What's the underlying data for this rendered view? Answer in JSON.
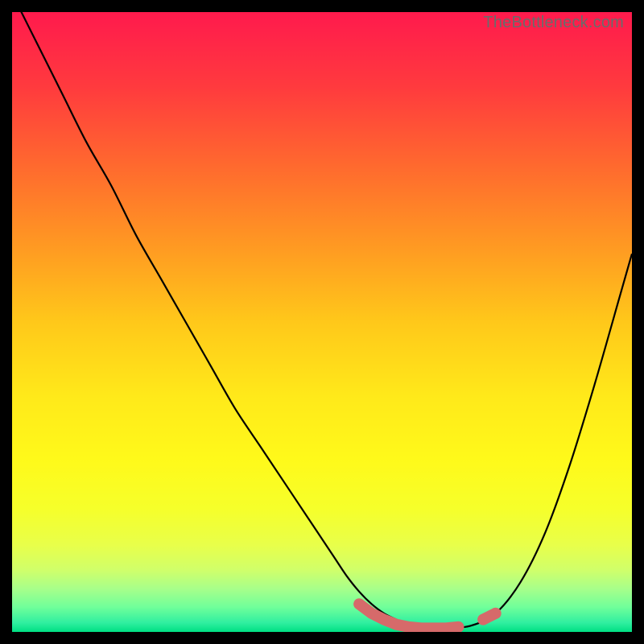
{
  "watermark": "TheBottleneck.com",
  "colors": {
    "black": "#000000",
    "curve": "#000000",
    "marker": "#d66a6a",
    "gradient_stops": [
      {
        "offset": 0.0,
        "color": "#ff1a4d"
      },
      {
        "offset": 0.12,
        "color": "#ff3a3e"
      },
      {
        "offset": 0.25,
        "color": "#ff6a2e"
      },
      {
        "offset": 0.38,
        "color": "#ff9a22"
      },
      {
        "offset": 0.5,
        "color": "#ffc81a"
      },
      {
        "offset": 0.62,
        "color": "#ffe91a"
      },
      {
        "offset": 0.72,
        "color": "#fff91a"
      },
      {
        "offset": 0.8,
        "color": "#f6ff2a"
      },
      {
        "offset": 0.86,
        "color": "#e8ff4a"
      },
      {
        "offset": 0.9,
        "color": "#d0ff6a"
      },
      {
        "offset": 0.93,
        "color": "#a8ff8a"
      },
      {
        "offset": 0.96,
        "color": "#70ff9a"
      },
      {
        "offset": 0.985,
        "color": "#30efa0"
      },
      {
        "offset": 1.0,
        "color": "#00e083"
      }
    ]
  },
  "chart_data": {
    "type": "line",
    "title": "",
    "xlabel": "",
    "ylabel": "",
    "xlim": [
      0,
      100
    ],
    "ylim": [
      0,
      100
    ],
    "grid": false,
    "legend": false,
    "x": [
      0,
      4,
      8,
      12,
      16,
      20,
      24,
      28,
      32,
      36,
      40,
      44,
      48,
      50,
      52,
      54,
      56,
      58,
      60,
      62,
      64,
      66,
      68,
      70,
      74,
      78,
      82,
      86,
      90,
      94,
      98,
      100
    ],
    "series": [
      {
        "name": "bottleneck-curve",
        "values": [
          103,
          95,
          87,
          79,
          72,
          64,
          57,
          50,
          43,
          36,
          30,
          24,
          18,
          15,
          12,
          9,
          6.5,
          4.5,
          3,
          2,
          1.2,
          0.8,
          0.6,
          0.6,
          1,
          3,
          8,
          16,
          27,
          40,
          54,
          61
        ]
      }
    ],
    "markers": {
      "name": "optimal-range",
      "style": "thick-pink",
      "segments": [
        {
          "x": [
            56,
            58,
            60,
            62,
            64,
            66,
            68,
            70,
            72
          ],
          "y": [
            4.5,
            3,
            2,
            1.2,
            0.8,
            0.6,
            0.6,
            0.6,
            0.8
          ]
        },
        {
          "x": [
            76,
            78
          ],
          "y": [
            2,
            3
          ]
        }
      ]
    }
  }
}
